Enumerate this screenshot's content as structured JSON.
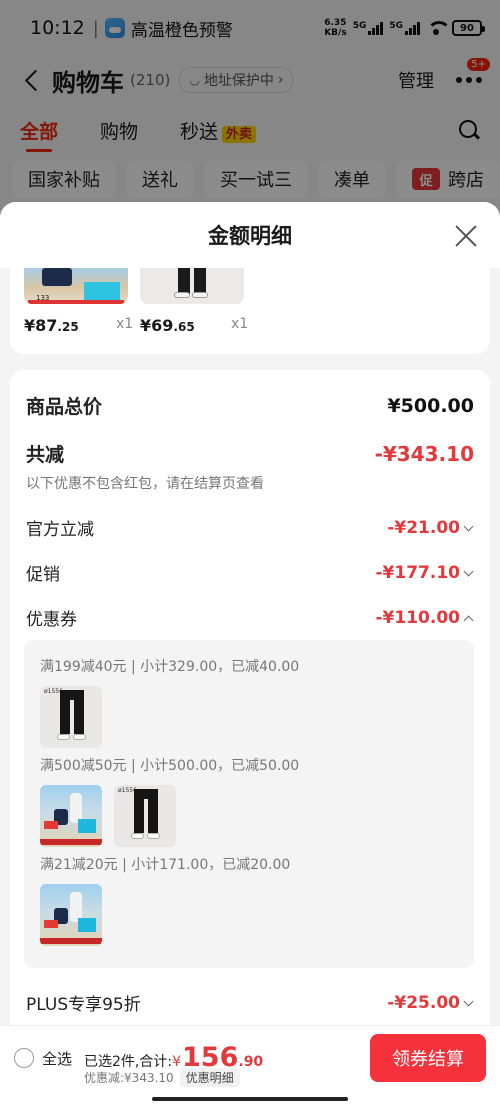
{
  "status_bar": {
    "time": "10:12",
    "alert": "高温橙色预警",
    "net_speed_value": "6.35",
    "net_speed_unit": "KB/s",
    "signal_label": "5G",
    "battery": "90"
  },
  "nav": {
    "title": "购物车",
    "count": "(210)",
    "address_label": "地址保护中",
    "manage": "管理",
    "badge": "5+"
  },
  "tabs": [
    {
      "label": "全部",
      "active": true
    },
    {
      "label": "购物",
      "active": false
    },
    {
      "label": "秒送",
      "active": false,
      "badge": "外卖"
    }
  ],
  "chips": [
    "国家补贴",
    "送礼",
    "买一试三",
    "凑单",
    "跨店"
  ],
  "promo_tag": "促",
  "sheet": {
    "title": "金额明细",
    "products": [
      {
        "thumb_text": "133",
        "price_int": "¥87",
        "price_dec": ".25",
        "qty": "x1"
      },
      {
        "price_int": "¥69",
        "price_dec": ".65",
        "qty": "x1"
      }
    ],
    "rows": {
      "total_label": "商品总价",
      "total_value": "¥500.00",
      "reduce_label": "共减",
      "reduce_value": "-¥343.10",
      "note": "以下优惠不包含红包，请在结算页查看",
      "official_label": "官方立减",
      "official_value": "-¥21.00",
      "promo_label": "促销",
      "promo_value": "-¥177.10",
      "coupon_label": "优惠券",
      "coupon_value": "-¥110.00",
      "plus_label": "PLUS专享95折",
      "plus_value": "-¥25.00"
    },
    "coupons": [
      {
        "text": "满199减40元 | 小计329.00，已减40.00"
      },
      {
        "text": "满500减50元 | 小计500.00，已减50.00"
      },
      {
        "text": "满21减20元 | 小计171.00，已减20.00"
      }
    ]
  },
  "bottom": {
    "select_all": "全选",
    "summary_prefix": "已选2件,合计:",
    "currency": "¥",
    "total_int": "156",
    "total_dec": ".90",
    "discount": "优惠减:¥343.10",
    "detail_button": "优惠明细",
    "checkout": "领券结算"
  },
  "colors": {
    "accent": "#e4393c",
    "checkout_bg": "#f5313b",
    "tab_active": "#f2270c",
    "badge_yellow": "#ffd400"
  }
}
